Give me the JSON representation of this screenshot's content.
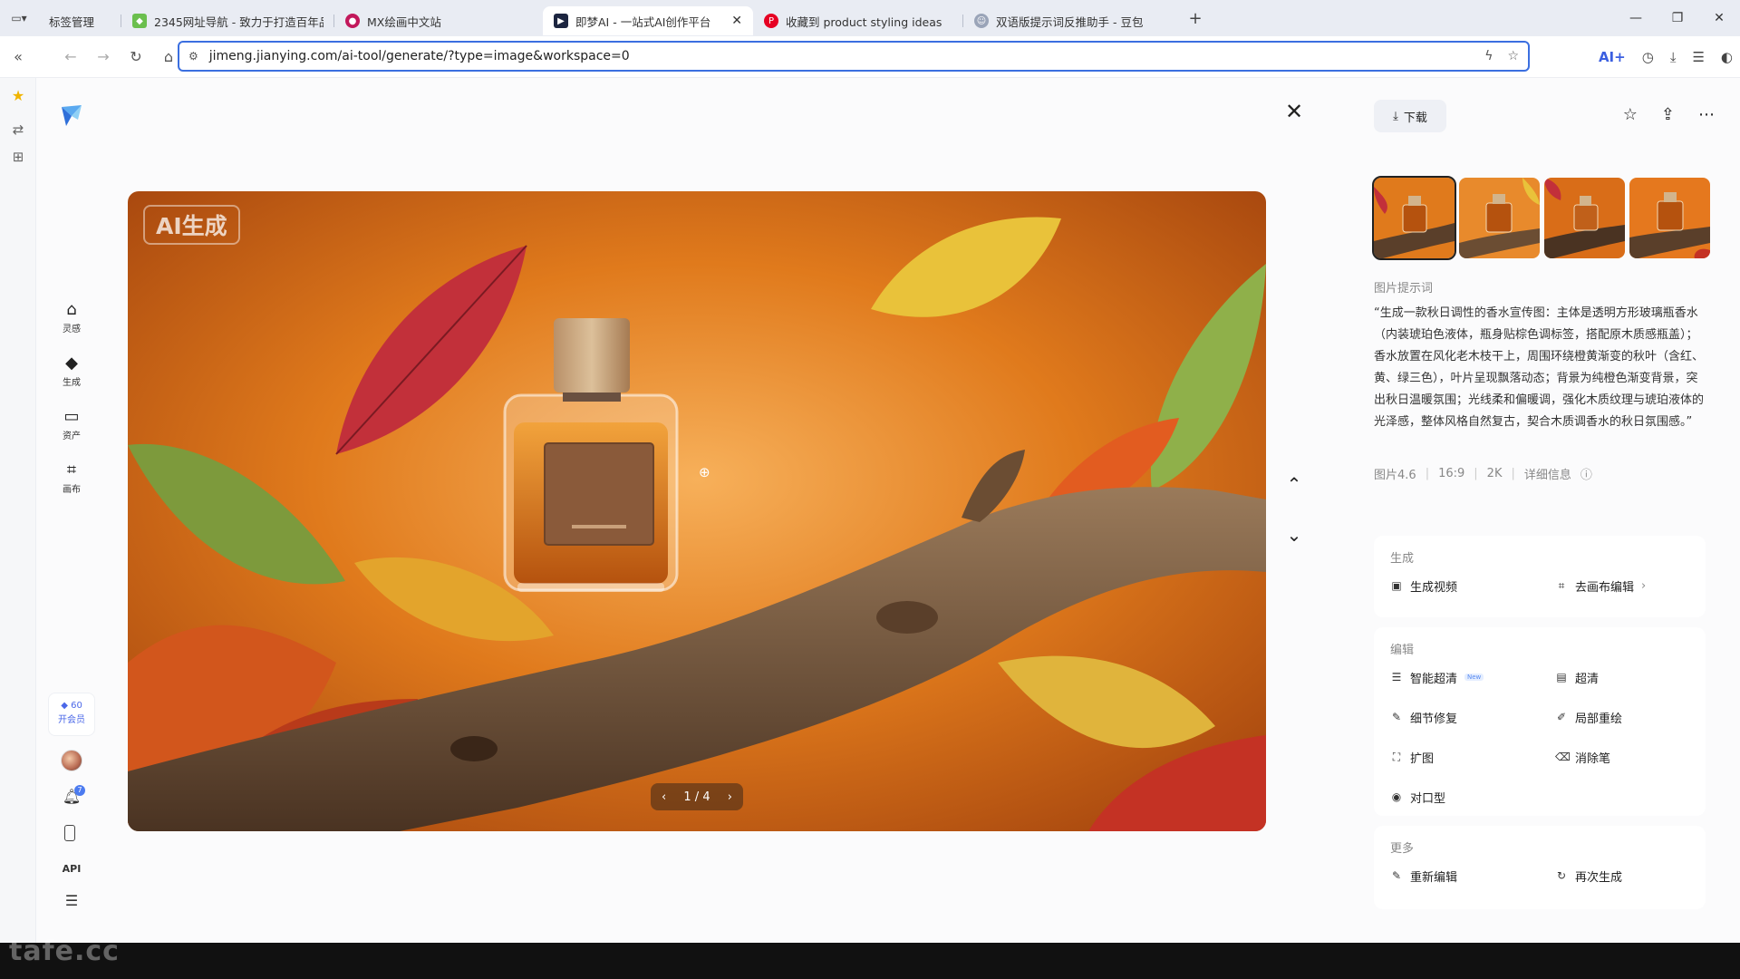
{
  "browser": {
    "tabs": [
      {
        "title": "标签管理",
        "icon": "bookmark-manager-icon"
      },
      {
        "title": "2345网址导航 - 致力于打造百年品",
        "icon": "nav-site-icon"
      },
      {
        "title": "MX绘画中文站",
        "icon": "mx-icon"
      },
      {
        "title": "即梦AI - 一站式AI创作平台",
        "icon": "jimeng-icon",
        "active": true
      },
      {
        "title": "收藏到 product styling ideas",
        "icon": "pinterest-icon"
      },
      {
        "title": "双语版提示词反推助手 - 豆包",
        "icon": "doubao-icon"
      }
    ],
    "url": "jimeng.jianying.com/ai-tool/generate/?type=image&workspace=0",
    "ai_label": "AI+"
  },
  "app_nav": {
    "items": [
      {
        "label": "灵感",
        "icon": "home-icon"
      },
      {
        "label": "生成",
        "icon": "diamond-icon"
      },
      {
        "label": "资产",
        "icon": "folder-icon"
      },
      {
        "label": "画布",
        "icon": "canvas-icon"
      }
    ],
    "credits": "60",
    "vip_label": "开会员",
    "notification_count": "7",
    "api_label": "API"
  },
  "viewer": {
    "ai_badge": "AI生成",
    "pager": "1 / 4"
  },
  "panel": {
    "download_label": "下载",
    "prompt_title": "图片提示词",
    "prompt_text": "“生成一款秋日调性的香水宣传图：主体是透明方形玻璃瓶香水（内装琥珀色液体，瓶身贴棕色调标签，搭配原木质感瓶盖）；香水放置在风化老木枝干上，周围环绕橙黄渐变的秋叶（含红、黄、绿三色），叶片呈现飘落动态；背景为纯橙色渐变背景，突出秋日温暖氛围；光线柔和偏暖调，强化木质纹理与琥珀液体的光泽感，整体风格自然复古，契合木质调香水的秋日氛围感。”",
    "meta": [
      "图片4.6",
      "16:9",
      "2K"
    ],
    "detail_label": "详细信息",
    "sections": [
      {
        "title": "生成",
        "options": [
          {
            "label": "生成视频",
            "icon": "video-icon"
          },
          {
            "label": "去画布编辑",
            "icon": "canvas-edit-icon",
            "chevron": true
          }
        ]
      },
      {
        "title": "编辑",
        "options": [
          {
            "label": "智能超清",
            "icon": "smart-hd-icon",
            "tag": "New"
          },
          {
            "label": "超清",
            "icon": "hd-icon"
          },
          {
            "label": "细节修复",
            "icon": "repair-icon"
          },
          {
            "label": "局部重绘",
            "icon": "inpaint-icon"
          },
          {
            "label": "扩图",
            "icon": "expand-icon"
          },
          {
            "label": "消除笔",
            "icon": "eraser-icon"
          },
          {
            "label": "对口型",
            "icon": "lipsync-icon"
          }
        ]
      },
      {
        "title": "更多",
        "options": [
          {
            "label": "重新编辑",
            "icon": "reedit-icon"
          },
          {
            "label": "再次生成",
            "icon": "regenerate-icon"
          }
        ]
      }
    ]
  },
  "watermark": "tafe.cc",
  "colors": {
    "accent": "#3b6fe0",
    "vip": "#4b68e8",
    "bg_orange": "#e07a1c"
  }
}
